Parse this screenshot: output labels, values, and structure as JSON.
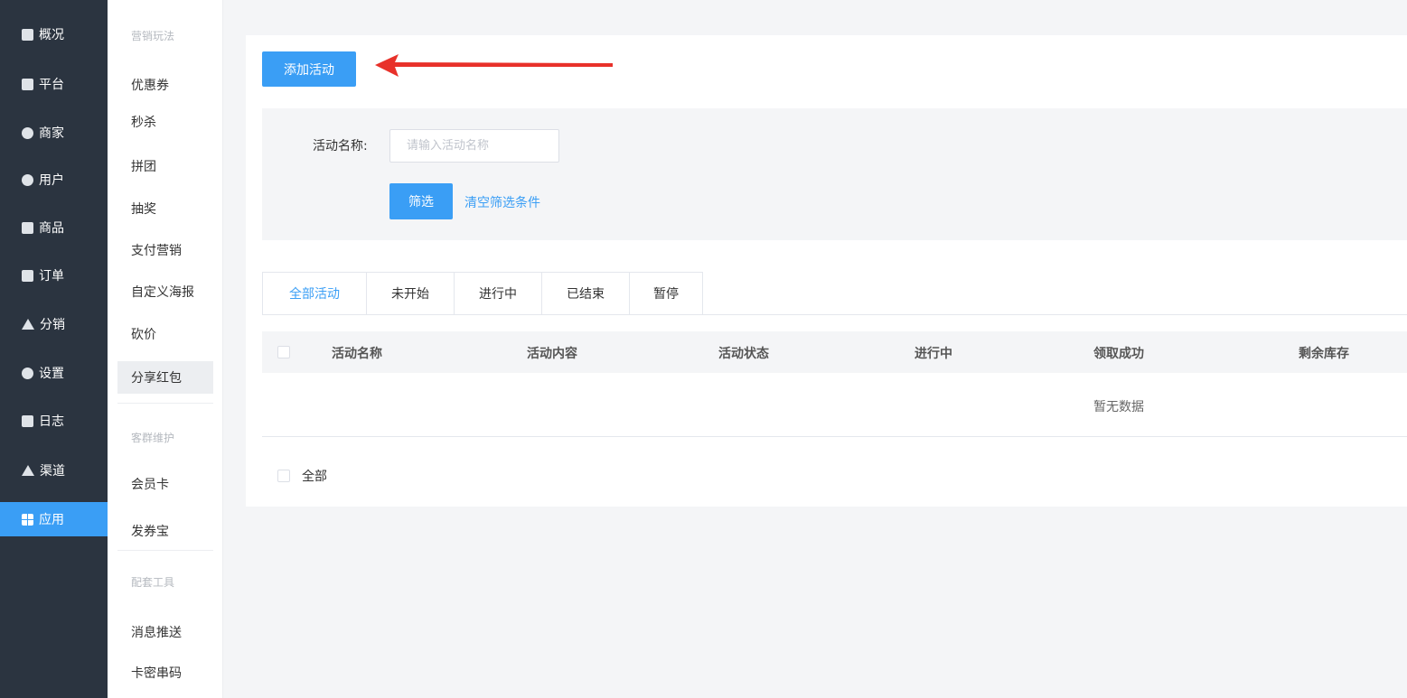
{
  "nav": {
    "items": [
      {
        "label": "概况",
        "icon": "monitor-icon"
      },
      {
        "label": "平台",
        "icon": "desktop-icon"
      },
      {
        "label": "商家",
        "icon": "store-icon"
      },
      {
        "label": "用户",
        "icon": "user-icon"
      },
      {
        "label": "商品",
        "icon": "product-icon"
      },
      {
        "label": "订单",
        "icon": "order-icon"
      },
      {
        "label": "分销",
        "icon": "distribution-icon"
      },
      {
        "label": "设置",
        "icon": "gear-icon"
      },
      {
        "label": "日志",
        "icon": "log-icon"
      },
      {
        "label": "渠道",
        "icon": "channel-icon"
      },
      {
        "label": "应用",
        "icon": "apps-grid-icon",
        "active": true
      }
    ]
  },
  "submenu": {
    "group1_title": "营销玩法",
    "group1_items": [
      "优惠券",
      "秒杀",
      "拼团",
      "抽奖",
      "支付营销",
      "自定义海报",
      "砍价",
      "分享红包"
    ],
    "active_item": "分享红包",
    "group2_title": "客群维护",
    "group2_items": [
      "会员卡",
      "发券宝"
    ],
    "group3_title": "配套工具",
    "group3_items": [
      "消息推送",
      "卡密串码"
    ]
  },
  "main": {
    "add_button": "添加活动",
    "filter": {
      "name_label": "活动名称:",
      "name_placeholder": "请输入活动名称",
      "filter_button": "筛选",
      "clear_link": "清空筛选条件"
    },
    "tabs": [
      "全部活动",
      "未开始",
      "进行中",
      "已结束",
      "暂停"
    ],
    "active_tab": "全部活动",
    "table": {
      "columns": [
        "活动名称",
        "活动内容",
        "活动状态",
        "进行中",
        "领取成功",
        "剩余库存"
      ],
      "empty_text": "暂无数据"
    },
    "select_all_label": "全部"
  },
  "colors": {
    "sidebar_bg": "#2b3440",
    "accent": "#3a9ef5",
    "arrow": "#e8312a"
  }
}
